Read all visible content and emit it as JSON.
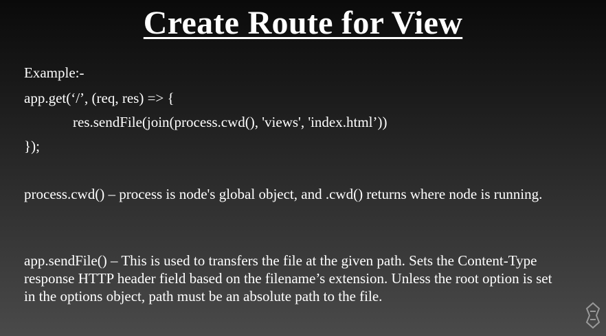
{
  "slide": {
    "title": "Create Route for View",
    "example_label": "Example:-",
    "code": {
      "line1": "app.get(‘/’, (req, res) => {",
      "line2": "res.sendFile(join(process.cwd(), 'views', 'index.html’))",
      "line3": "});"
    },
    "paragraphs": [
      "process.cwd() – process is node's global object, and .cwd() returns where node is running.",
      "app.sendFile() – This is used to transfers the file at the given path. Sets the Content-Type response HTTP header field based on the filename’s extension. Unless the root option is set in the options object, path must be an absolute path to the file."
    ]
  }
}
